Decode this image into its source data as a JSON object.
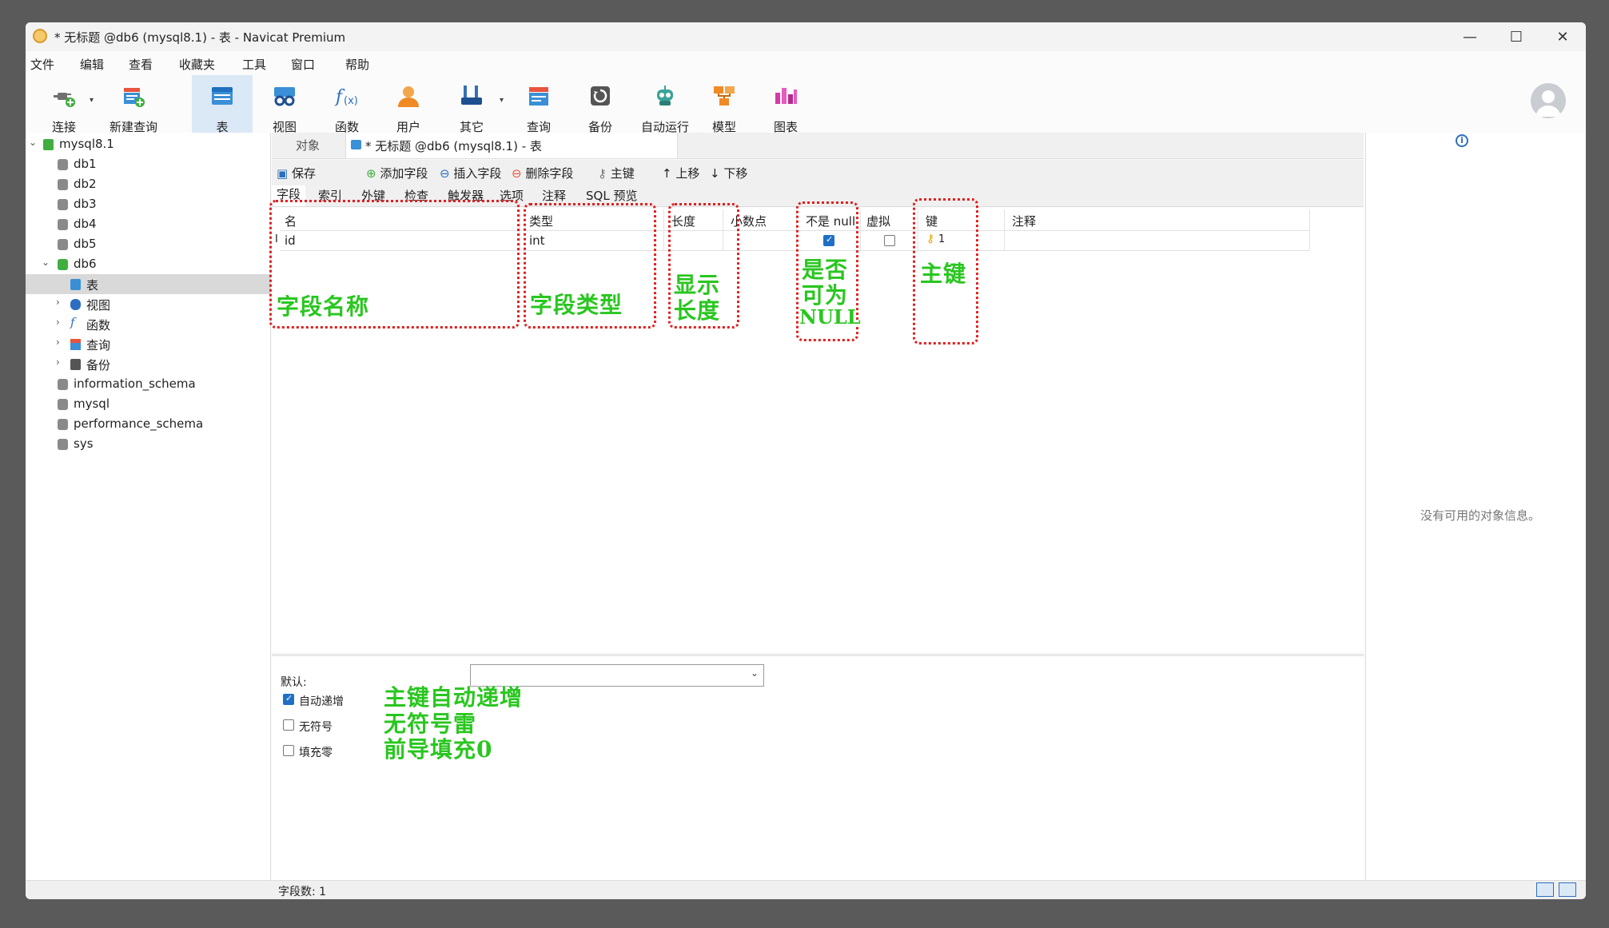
{
  "window": {
    "title": "* 无标题 @db6 (mysql8.1) - 表 - Navicat Premium"
  },
  "window_controls": {
    "minimize": "—",
    "maximize": "☐",
    "close": "✕"
  },
  "menu": [
    "文件",
    "编辑",
    "查看",
    "收藏夹",
    "工具",
    "窗口",
    "帮助"
  ],
  "toolbar": {
    "connect": "连接",
    "new_query": "新建查询",
    "table": "表",
    "view": "视图",
    "function": "函数",
    "user": "用户",
    "other": "其它",
    "query": "查询",
    "backup": "备份",
    "automation": "自动运行",
    "model": "模型",
    "chart": "图表"
  },
  "sidebar": {
    "connection": "mysql8.1",
    "databases": [
      "db1",
      "db2",
      "db3",
      "db4",
      "db5",
      "db6"
    ],
    "db6_children": [
      "表",
      "视图",
      "函数",
      "查询",
      "备份"
    ],
    "other_databases": [
      "information_schema",
      "mysql",
      "performance_schema",
      "sys"
    ]
  },
  "tabs": {
    "objects": "对象",
    "active": "* 无标题 @db6 (mysql8.1) - 表"
  },
  "actions": {
    "save": "保存",
    "add_field": "添加字段",
    "insert_field": "插入字段",
    "delete_field": "删除字段",
    "primary_key": "主键",
    "move_up": "上移",
    "move_down": "下移"
  },
  "subtabs": [
    "字段",
    "索引",
    "外键",
    "检查",
    "触发器",
    "选项",
    "注释",
    "SQL 预览"
  ],
  "grid": {
    "headers": {
      "name": "名",
      "type": "类型",
      "length": "长度",
      "decimals": "小数点",
      "not_null": "不是 null",
      "virtual": "虚拟",
      "key": "键",
      "comment": "注释"
    },
    "row": {
      "marker": "I",
      "name": "id",
      "type": "int",
      "length": "",
      "decimals": "",
      "not_null": true,
      "virtual": false,
      "key": "1",
      "comment": ""
    }
  },
  "annotations": {
    "field_name": "字段名称",
    "field_type": "字段类型",
    "display_length_1": "显示",
    "display_length_2": "长度",
    "nullable_1": "是否",
    "nullable_2": "可为",
    "nullable_3": "NULL",
    "primary_key": "主键",
    "auto_increment": "主键自动递增",
    "unsigned": "无符号雷",
    "zerofill": "前导填充0"
  },
  "properties": {
    "default_label": "默认:",
    "default_value": "",
    "auto_increment_label": "自动递增",
    "auto_increment": true,
    "unsigned_label": "无符号",
    "unsigned": false,
    "zerofill_label": "填充零",
    "zerofill": false
  },
  "info_pane": {
    "empty": "没有可用的对象信息。"
  },
  "status": {
    "field_count": "字段数: 1"
  },
  "colors": {
    "annotation_text": "#29c61f",
    "annotation_border": "#e02020",
    "selected_toolbar": "#dbe8f6",
    "accent": "#1f6fc6"
  }
}
